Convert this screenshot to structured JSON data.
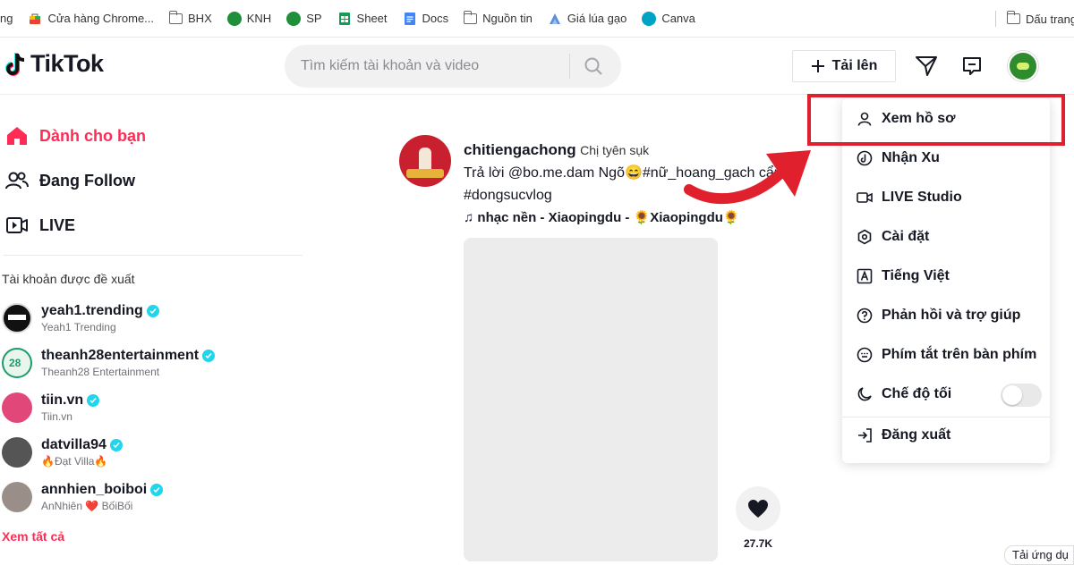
{
  "bookmarks": [
    {
      "label": "ng",
      "icon": "none"
    },
    {
      "label": "Cửa hàng Chrome...",
      "icon": "chrome-store-icon"
    },
    {
      "label": "BHX",
      "icon": "folder-icon"
    },
    {
      "label": "KNH",
      "icon": "green-circle-icon"
    },
    {
      "label": "SP",
      "icon": "green-circle-icon"
    },
    {
      "label": "Sheet",
      "icon": "sheets-icon"
    },
    {
      "label": "Docs",
      "icon": "docs-icon"
    },
    {
      "label": "Nguồn tin",
      "icon": "folder-icon"
    },
    {
      "label": "Giá lúa gạo",
      "icon": "chart-icon"
    },
    {
      "label": "Canva",
      "icon": "canva-icon"
    }
  ],
  "bookmark_right": "Dấu trang",
  "header": {
    "logo_text": "TikTok",
    "search_placeholder": "Tìm kiếm tài khoản và video",
    "upload_label": "Tải lên"
  },
  "sidebar": {
    "nav": [
      {
        "label": "Dành cho bạn",
        "icon": "home-icon",
        "active": true
      },
      {
        "label": "Đang Follow",
        "icon": "people-icon",
        "active": false
      },
      {
        "label": "LIVE",
        "icon": "live-icon",
        "active": false
      }
    ],
    "suggested_title": "Tài khoản được đề xuất",
    "accounts": [
      {
        "name": "yeah1.trending",
        "sub": "Yeah1 Trending"
      },
      {
        "name": "theanh28entertainment",
        "sub": "Theanh28 Entertainment"
      },
      {
        "name": "tiin.vn",
        "sub": "Tiin.vn"
      },
      {
        "name": "datvilla94",
        "sub": "🔥Đạt Villa🔥"
      },
      {
        "name": "annhien_boiboi",
        "sub": "AnNhiên ❤️ BốiBối"
      }
    ],
    "see_all": "Xem tất cả"
  },
  "post": {
    "username": "chitiengachong",
    "nickname": "Chị tyên sụk",
    "caption_line1": "Trả lời @bo.me.dam Ngõ😄#nữ_hoang_gach cẩm",
    "caption_line2": "#dongsucvlog",
    "music": "♫ nhạc nền - Xiaopingdu - 🌻Xiaopingdu🌻",
    "like_count": "27.7K"
  },
  "menu": {
    "items": [
      {
        "label": "Xem hồ sơ",
        "icon": "person-icon"
      },
      {
        "label": "Nhận Xu",
        "icon": "tiktok-coin-icon"
      },
      {
        "label": "LIVE Studio",
        "icon": "live-studio-icon"
      },
      {
        "label": "Cài đặt",
        "icon": "settings-icon"
      },
      {
        "label": "Tiếng Việt",
        "icon": "language-icon"
      },
      {
        "label": "Phản hồi và trợ giúp",
        "icon": "help-icon"
      },
      {
        "label": "Phím tắt trên bàn phím",
        "icon": "keyboard-icon"
      },
      {
        "label": "Chế độ tối",
        "icon": "moon-icon"
      },
      {
        "label": "Đăng xuất",
        "icon": "logout-icon"
      }
    ],
    "dark_mode_on": false
  },
  "app_button": "Tải ứng dụ",
  "colors": {
    "accent": "#fe2c55",
    "highlight": "#e1202d",
    "verified": "#20d5ec"
  }
}
